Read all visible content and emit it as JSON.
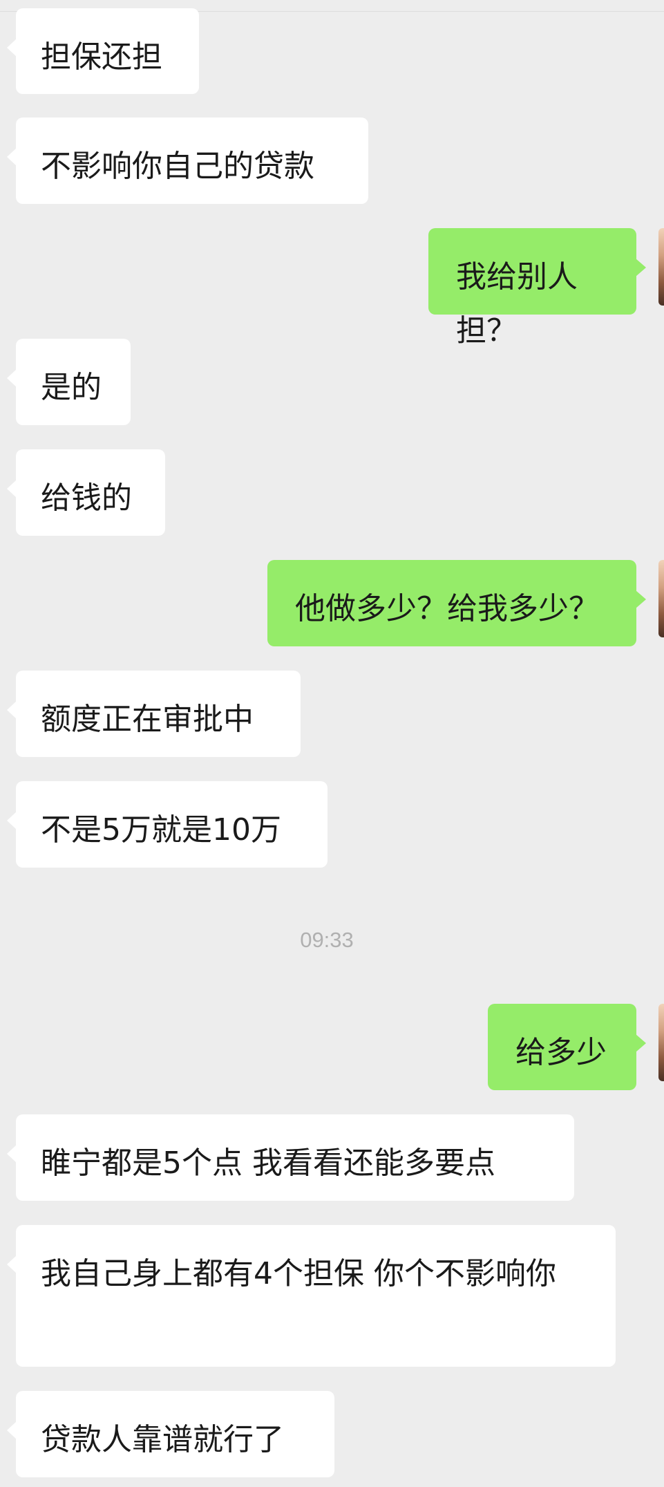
{
  "messages": [
    {
      "id": "m1",
      "side": "incoming",
      "text": "担保还担"
    },
    {
      "id": "m2",
      "side": "incoming",
      "text": "不影响你自己的贷款"
    },
    {
      "id": "m3",
      "side": "outgoing",
      "text": "我给别人担？"
    },
    {
      "id": "m4",
      "side": "incoming",
      "text": "是的"
    },
    {
      "id": "m5",
      "side": "incoming",
      "text": "给钱的"
    },
    {
      "id": "m6",
      "side": "outgoing",
      "text": "他做多少？给我多少？"
    },
    {
      "id": "m7",
      "side": "incoming",
      "text": "额度正在审批中"
    },
    {
      "id": "m8",
      "side": "incoming",
      "text": "不是5万就是10万"
    },
    {
      "id": "m9",
      "side": "outgoing",
      "text": "给多少"
    },
    {
      "id": "m10",
      "side": "incoming",
      "text": "睢宁都是5个点 我看看还能多要点"
    },
    {
      "id": "m11",
      "side": "incoming",
      "text": "我自己身上都有4个担保 你个不影响你"
    },
    {
      "id": "m12",
      "side": "incoming",
      "text": "贷款人靠谱就行了"
    }
  ],
  "timestamp": "09:33",
  "colors": {
    "background": "#ededed",
    "incoming_bubble": "#ffffff",
    "outgoing_bubble": "#95ec69",
    "timestamp_text": "#b0b0b0"
  }
}
